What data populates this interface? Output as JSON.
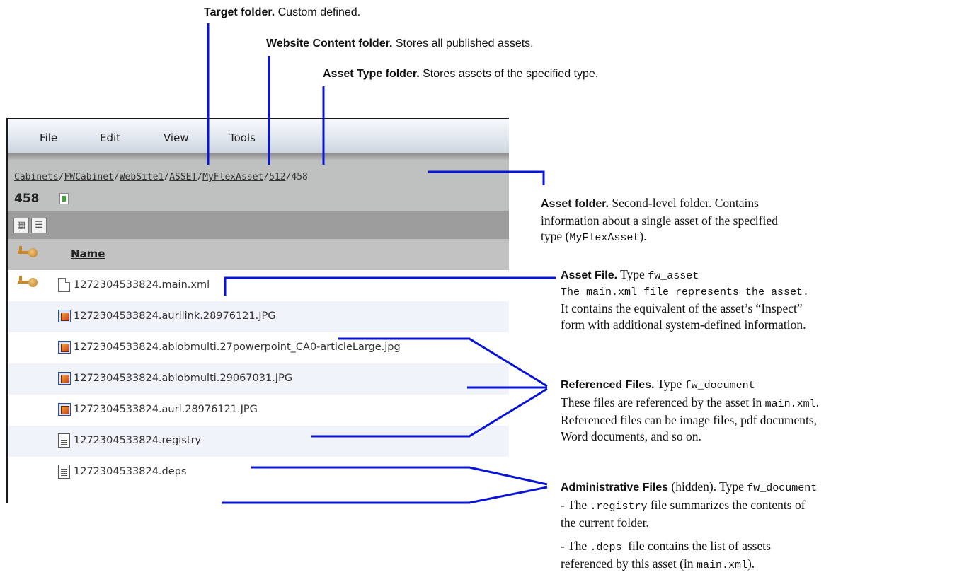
{
  "callouts": {
    "target": {
      "bold": "Target folder.",
      "text": " Custom defined."
    },
    "website": {
      "bold": "Website Content folder.",
      "text": " Stores all published assets."
    },
    "asset_type": {
      "bold": "Asset Type folder.",
      "text": " Stores assets of the specified type."
    },
    "asset_folder": {
      "bold": "Asset folder.",
      "line1": " Second-level folder. Contains",
      "line2": "information about a single asset of the specified",
      "line3_pre": "type (",
      "line3_code": "MyFlexAsset",
      "line3_post": ")."
    },
    "asset_file": {
      "bold": "Asset File.",
      "line1": " Type ",
      "line1_code": "fw_asset",
      "line2_code": "The main.xml file represents the asset.",
      "line3": "It contains the equivalent of the asset’s “Inspect”",
      "line4": "form with additional system-defined information."
    },
    "referenced": {
      "bold": "Referenced Files.",
      "line1": " Type ",
      "line1_code": "fw_document",
      "line2_pre": "These files are referenced by the asset in ",
      "line2_code": "main.xml",
      "line2_post": ".",
      "line3": "Referenced files can be image files, pdf documents,",
      "line4": "Word documents, and so on."
    },
    "admin": {
      "bold": "Administrative Files",
      "line1": " (hidden). Type ",
      "line1_code": "fw_document",
      "line2_pre": "- The ",
      "line2_code": ".registry",
      "line2_post": " file summarizes the contents of",
      "line3": "the current folder.",
      "line4_pre": "- The ",
      "line4_code": ".deps",
      "line4_post": "  file contains the list of assets",
      "line5_pre": "referenced by this asset (in ",
      "line5_code": "main.xml",
      "line5_post": ")."
    }
  },
  "menu": [
    "File",
    "Edit",
    "View",
    "Tools"
  ],
  "breadcrumb": [
    "Cabinets",
    "FWCabinet",
    "WebSite1",
    "ASSET",
    "MyFlexAsset",
    "512",
    "458"
  ],
  "folder_title": "458",
  "view_buttons": [
    "thumbnail-view",
    "list-view"
  ],
  "column_header": "Name",
  "files": [
    {
      "name": "1272304533824.main.xml",
      "icon": "blank-file-icon"
    },
    {
      "name": "1272304533824.aurllink.28976121.JPG",
      "icon": "image-file-icon"
    },
    {
      "name": "1272304533824.ablobmulti.27powerpoint_CA0-articleLarge.jpg",
      "icon": "image-file-icon"
    },
    {
      "name": "1272304533824.ablobmulti.29067031.JPG",
      "icon": "image-file-icon"
    },
    {
      "name": "1272304533824.aurl.28976121.JPG",
      "icon": "image-file-icon"
    },
    {
      "name": "1272304533824.registry",
      "icon": "text-file-icon"
    },
    {
      "name": "1272304533824.deps",
      "icon": "text-file-icon"
    }
  ],
  "colors": {
    "connector": "#0a14d6",
    "menubar": "#e2e8f0",
    "crumbs": "#bfc0c0",
    "toolbar": "#9d9d9d",
    "header": "#c2c2c2"
  }
}
